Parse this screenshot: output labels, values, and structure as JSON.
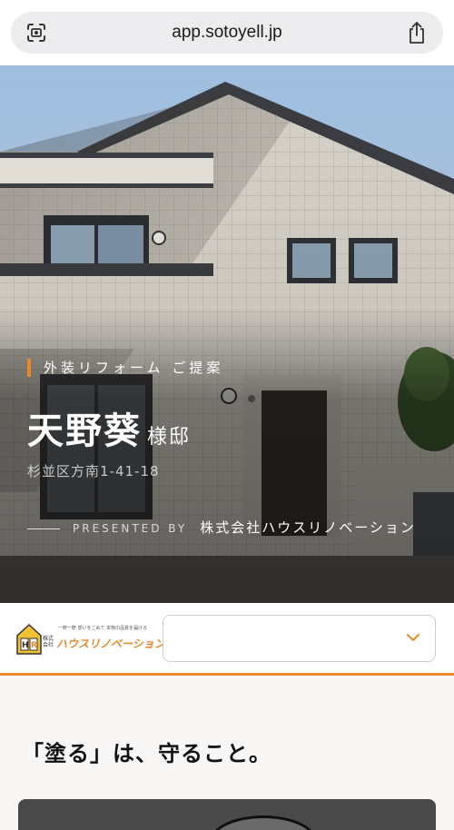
{
  "browser": {
    "url": "app.sotoyell.jp",
    "left_icon": "camera-scan-icon",
    "right_icon": "share-icon"
  },
  "hero": {
    "eyebrow": "外装リフォーム ご提案",
    "customer_name": "天野葵",
    "name_suffix": "様邸",
    "address": "杉並区方南1-41-18",
    "presented_label": "PRESENTED BY",
    "company": "株式会社ハウスリノベーション"
  },
  "company_bar": {
    "logo_tagline": "一軒一軒 想いをこめて 本物の品質を届ける",
    "logo_small": "株式会社",
    "logo_brand": "ハウスリノベーション",
    "select_value": "",
    "select_icon": "chevron-down-icon"
  },
  "content": {
    "section_title": "「塗る」は、守ること。"
  },
  "colors": {
    "accent": "#e8892c"
  }
}
